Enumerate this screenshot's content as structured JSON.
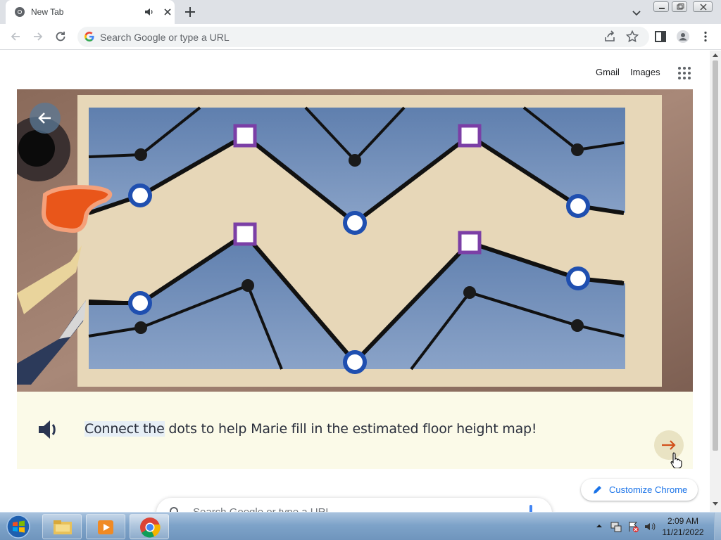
{
  "tab": {
    "title": "New Tab"
  },
  "omnibox": {
    "placeholder": "Search Google or type a URL"
  },
  "header_links": {
    "gmail": "Gmail",
    "images": "Images"
  },
  "doodle": {
    "caption_plain": "Connect the",
    "caption_rest": " dots to help Marie fill in the estimated floor height map!"
  },
  "customize": {
    "label": "Customize Chrome"
  },
  "ntp_search": {
    "placeholder": "Search Google or type a URL"
  },
  "clock": {
    "time": "2:09 AM",
    "date": "11/21/2022"
  },
  "icons": [
    "chrome-favicon",
    "audio-icon",
    "close-icon",
    "plus-icon",
    "chevron-down-icon",
    "back-icon",
    "forward-icon",
    "reload-icon",
    "google-g-icon",
    "share-icon",
    "star-icon",
    "side-panel-icon",
    "profile-icon",
    "kebab-menu-icon",
    "apps-grid-icon",
    "speaker-icon",
    "next-arrow-icon",
    "pencil-icon",
    "search-icon"
  ],
  "colors": {
    "accent": "#1a73e8",
    "doodle_ring": "#1f4fb0",
    "doodle_square": "#7b3fa6",
    "doodle_blob": "#e9561a"
  }
}
